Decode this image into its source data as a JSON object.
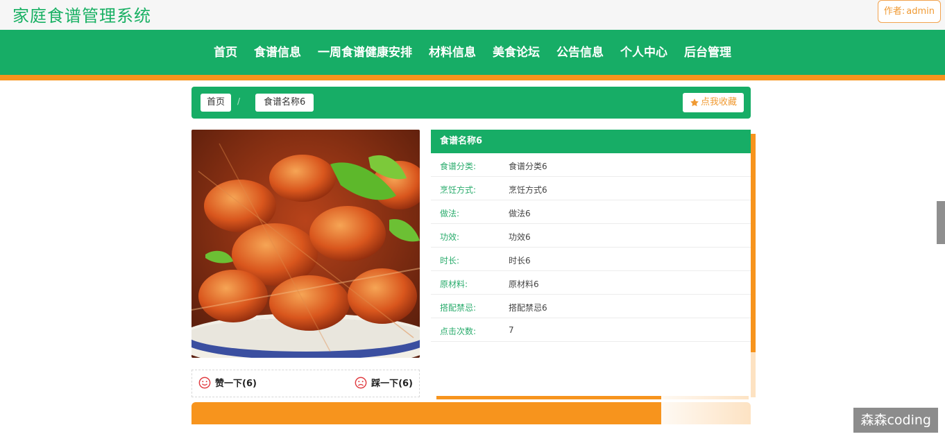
{
  "header": {
    "site_title": "家庭食谱管理系统",
    "author_label": "作者:",
    "author_name": "admin"
  },
  "nav": {
    "items": [
      {
        "label": "首页"
      },
      {
        "label": "食谱信息"
      },
      {
        "label": "一周食谱健康安排"
      },
      {
        "label": "材料信息"
      },
      {
        "label": "美食论坛"
      },
      {
        "label": "公告信息"
      },
      {
        "label": "个人中心"
      },
      {
        "label": "后台管理"
      }
    ]
  },
  "breadcrumb": {
    "home": "首页",
    "separator": "/",
    "current": "食谱名称6",
    "favorite_label": "点我收藏",
    "favorite_icon": "star-icon"
  },
  "detail": {
    "title": "食谱名称6",
    "rows": [
      {
        "label": "食谱分类:",
        "value": "食谱分类6"
      },
      {
        "label": "烹饪方式:",
        "value": "烹饪方式6"
      },
      {
        "label": "做法:",
        "value": "做法6"
      },
      {
        "label": "功效:",
        "value": "功效6"
      },
      {
        "label": "时长:",
        "value": "时长6"
      },
      {
        "label": "原材料:",
        "value": "原材料6"
      },
      {
        "label": "搭配禁忌:",
        "value": "搭配禁忌6"
      },
      {
        "label": "点击次数:",
        "value": "7"
      }
    ]
  },
  "votes": {
    "like_label": "赞一下(6)",
    "dislike_label": "踩一下(6)"
  },
  "watermark": "森森coding",
  "colors": {
    "primary": "#17ad66",
    "accent": "#f7941d"
  }
}
